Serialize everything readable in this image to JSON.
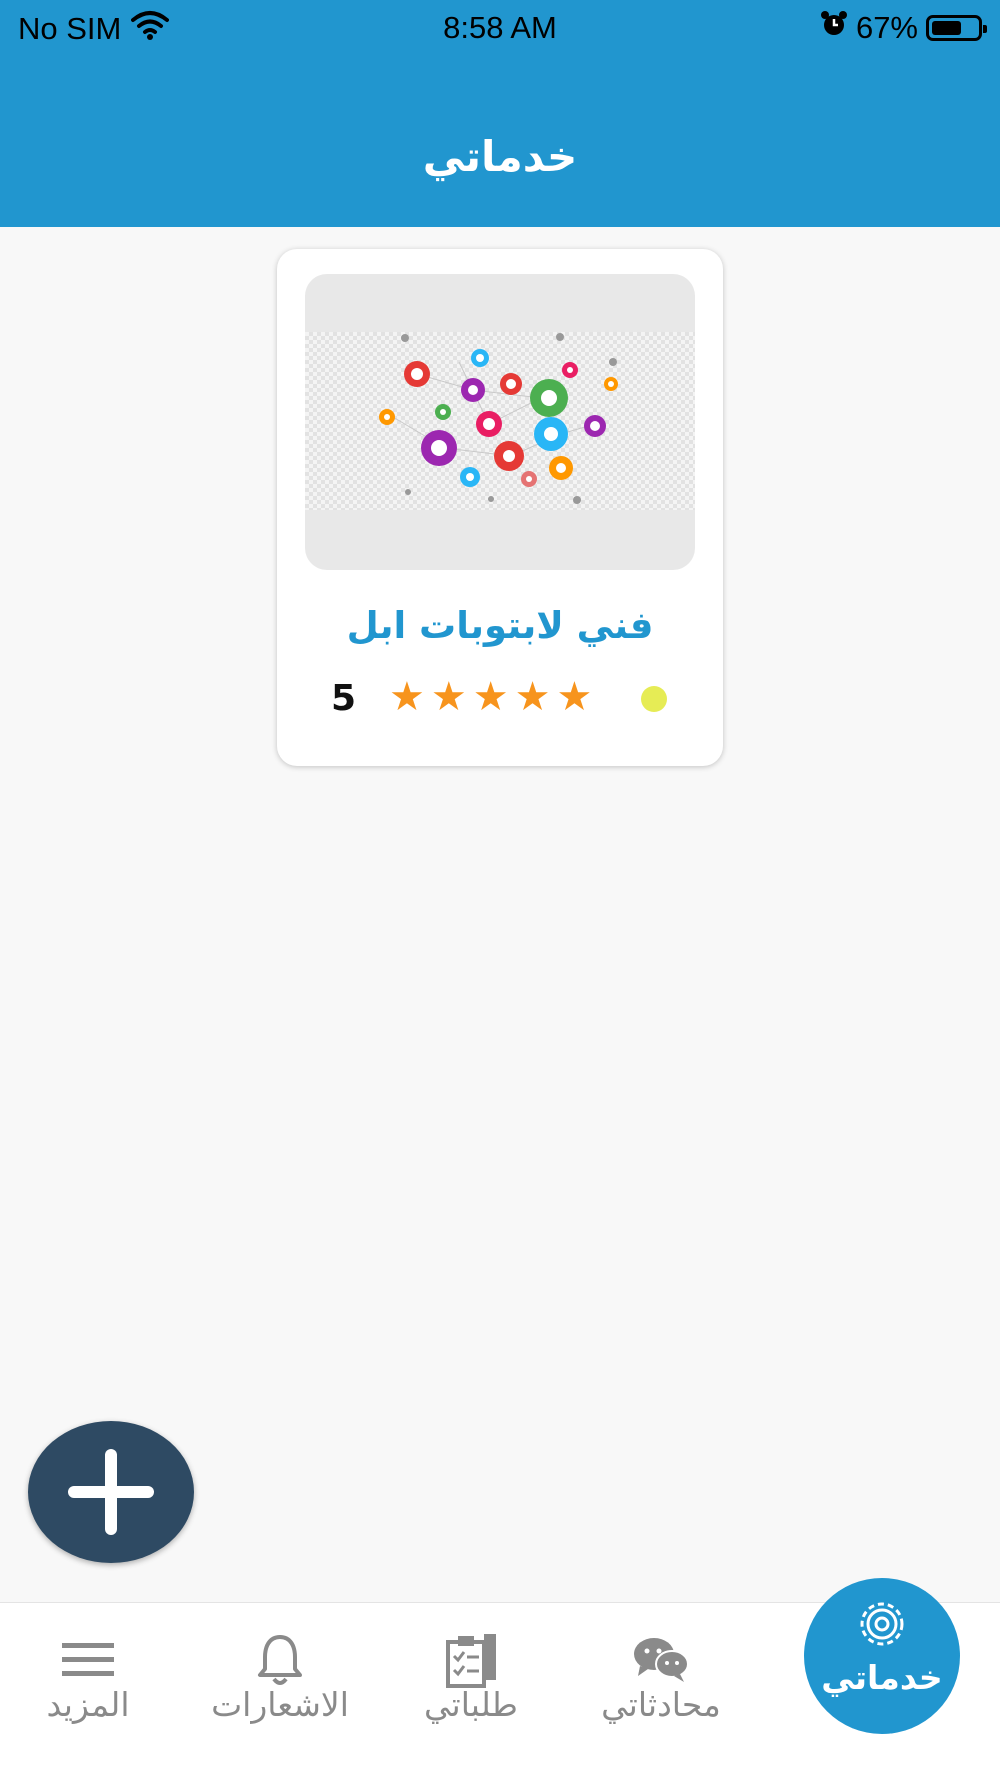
{
  "status_bar": {
    "carrier": "No SIM",
    "time": "8:58 AM",
    "battery_percent": "67%",
    "battery_level": 0.67
  },
  "header": {
    "title": "خدماتي",
    "color": "#2196cf"
  },
  "services": [
    {
      "title": "فني لابتوبات ابل",
      "rating": "5",
      "stars_filled": 5,
      "status_color": "#e6ec55",
      "image_icon": "network-icons-illustration"
    }
  ],
  "fab": {
    "icon": "plus-icon",
    "color": "#2e4a63"
  },
  "tabbar": {
    "items": [
      {
        "label": "المزيد",
        "icon": "menu-icon"
      },
      {
        "label": "الاشعارات",
        "icon": "bell-icon"
      },
      {
        "label": "طلباتي",
        "icon": "clipboard-icon"
      },
      {
        "label": "محادثاتي",
        "icon": "chat-icon"
      },
      {
        "label": "خدماتي",
        "icon": "gear-icon",
        "active": true
      }
    ]
  }
}
